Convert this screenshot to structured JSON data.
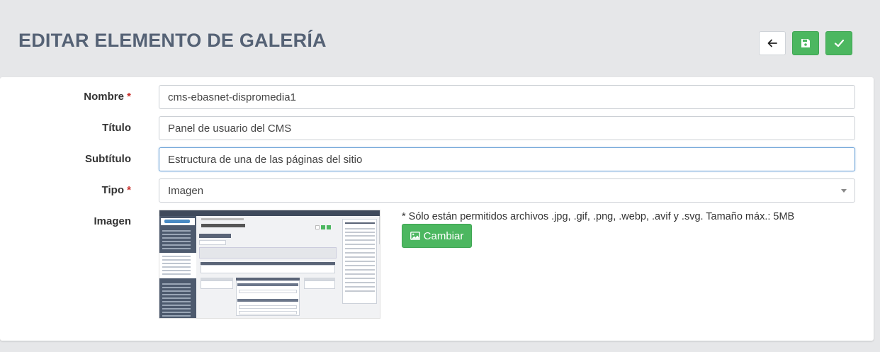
{
  "page": {
    "title": "EDITAR ELEMENTO DE GALERÍA"
  },
  "header_buttons": {
    "back_icon": "arrow-left-icon",
    "save_icon": "floppy-disk-icon",
    "confirm_icon": "check-icon"
  },
  "form": {
    "required_mark": "*",
    "nombre": {
      "label": "Nombre",
      "value": "cms-ebasnet-dispromedia1"
    },
    "titulo": {
      "label": "Título",
      "value": "Panel de usuario del CMS"
    },
    "subtitulo": {
      "label": "Subtítulo",
      "value": "Estructura de una de las páginas del sitio"
    },
    "tipo": {
      "label": "Tipo",
      "value": "Imagen"
    },
    "imagen": {
      "label": "Imagen",
      "note": "* Sólo están permitidos archivos .jpg, .gif, .png, .webp, .avif y .svg. Tamaño máx.: 5MB",
      "change_button": "Cambiar",
      "change_icon": "image-icon"
    }
  },
  "colors": {
    "accent_green": "#4cb760",
    "title_color": "#556275",
    "required_red": "#c9302c"
  }
}
